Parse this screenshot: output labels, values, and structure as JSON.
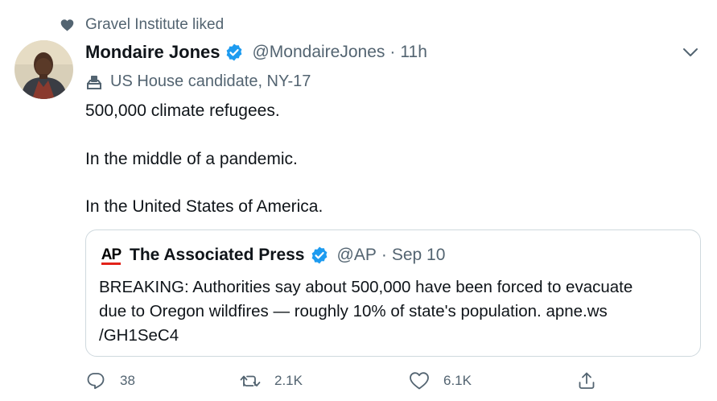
{
  "social_context": {
    "text": "Gravel Institute liked",
    "icon": "heart-icon"
  },
  "author": {
    "display_name": "Mondaire Jones",
    "handle": "@MondaireJones",
    "separator": "·",
    "time": "11h",
    "verified": true,
    "label": "US House candidate, NY-17"
  },
  "tweet": {
    "lines": [
      "500,000 climate refugees.",
      "In the middle of a pandemic.",
      "In the United States of America."
    ]
  },
  "quoted": {
    "logo_text": "AP",
    "display_name": "The Associated Press",
    "handle": "@AP",
    "separator": "·",
    "date": "Sep 10",
    "verified": true,
    "body_lines": [
      "BREAKING: Authorities say about 500,000 have been forced to evacuate",
      "due to Oregon wildfires —  roughly 10% of state's population. apne.ws",
      "/GH1SeC4"
    ]
  },
  "actions": {
    "reply_count": "38",
    "retweet_count": "2.1K",
    "like_count": "6.1K"
  },
  "colors": {
    "text_primary": "#0f1419",
    "text_secondary": "#536471",
    "verified_blue": "#1d9bf0",
    "border": "#cfd9de",
    "ap_red": "#e2231a"
  }
}
